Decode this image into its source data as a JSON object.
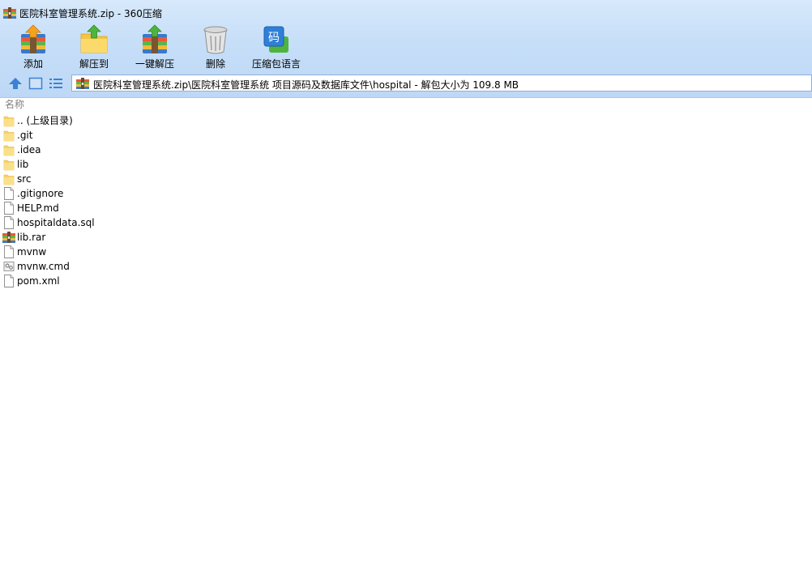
{
  "window": {
    "title": "医院科室管理系统.zip - 360压缩",
    "title_icon": "archive-icon"
  },
  "toolbar": {
    "buttons": [
      {
        "label": "添加",
        "icon": "add-archive-icon"
      },
      {
        "label": "解压到",
        "icon": "extract-to-folder-icon"
      },
      {
        "label": "一键解压",
        "icon": "one-click-extract-icon"
      },
      {
        "label": "删除",
        "icon": "trash-can-icon"
      },
      {
        "label": "压缩包语言",
        "icon": "archive-language-icon",
        "icon_text": "码"
      }
    ]
  },
  "nav": {
    "up": "up-arrow-icon",
    "view": "view-thumbnail-icon",
    "list": "view-list-icon"
  },
  "address": {
    "path": "医院科室管理系统.zip\\医院科室管理系统 项目源码及数据库文件\\hospital - 解包大小为 109.8 MB"
  },
  "file_list": {
    "column_name": "名称",
    "items": [
      {
        "name": ".. (上级目录)",
        "type": "folder"
      },
      {
        "name": ".git",
        "type": "folder"
      },
      {
        "name": ".idea",
        "type": "folder"
      },
      {
        "name": "lib",
        "type": "folder"
      },
      {
        "name": "src",
        "type": "folder"
      },
      {
        "name": ".gitignore",
        "type": "file"
      },
      {
        "name": "HELP.md",
        "type": "file"
      },
      {
        "name": "hospitaldata.sql",
        "type": "file"
      },
      {
        "name": "lib.rar",
        "type": "archive"
      },
      {
        "name": "mvnw",
        "type": "file"
      },
      {
        "name": "mvnw.cmd",
        "type": "cmd"
      },
      {
        "name": "pom.xml",
        "type": "file"
      }
    ]
  },
  "colors": {
    "toolbar_top": "#d7e9fb",
    "toolbar_bottom": "#bdd8f6",
    "folder": "#f7d268",
    "accent": "#3a82d6"
  }
}
